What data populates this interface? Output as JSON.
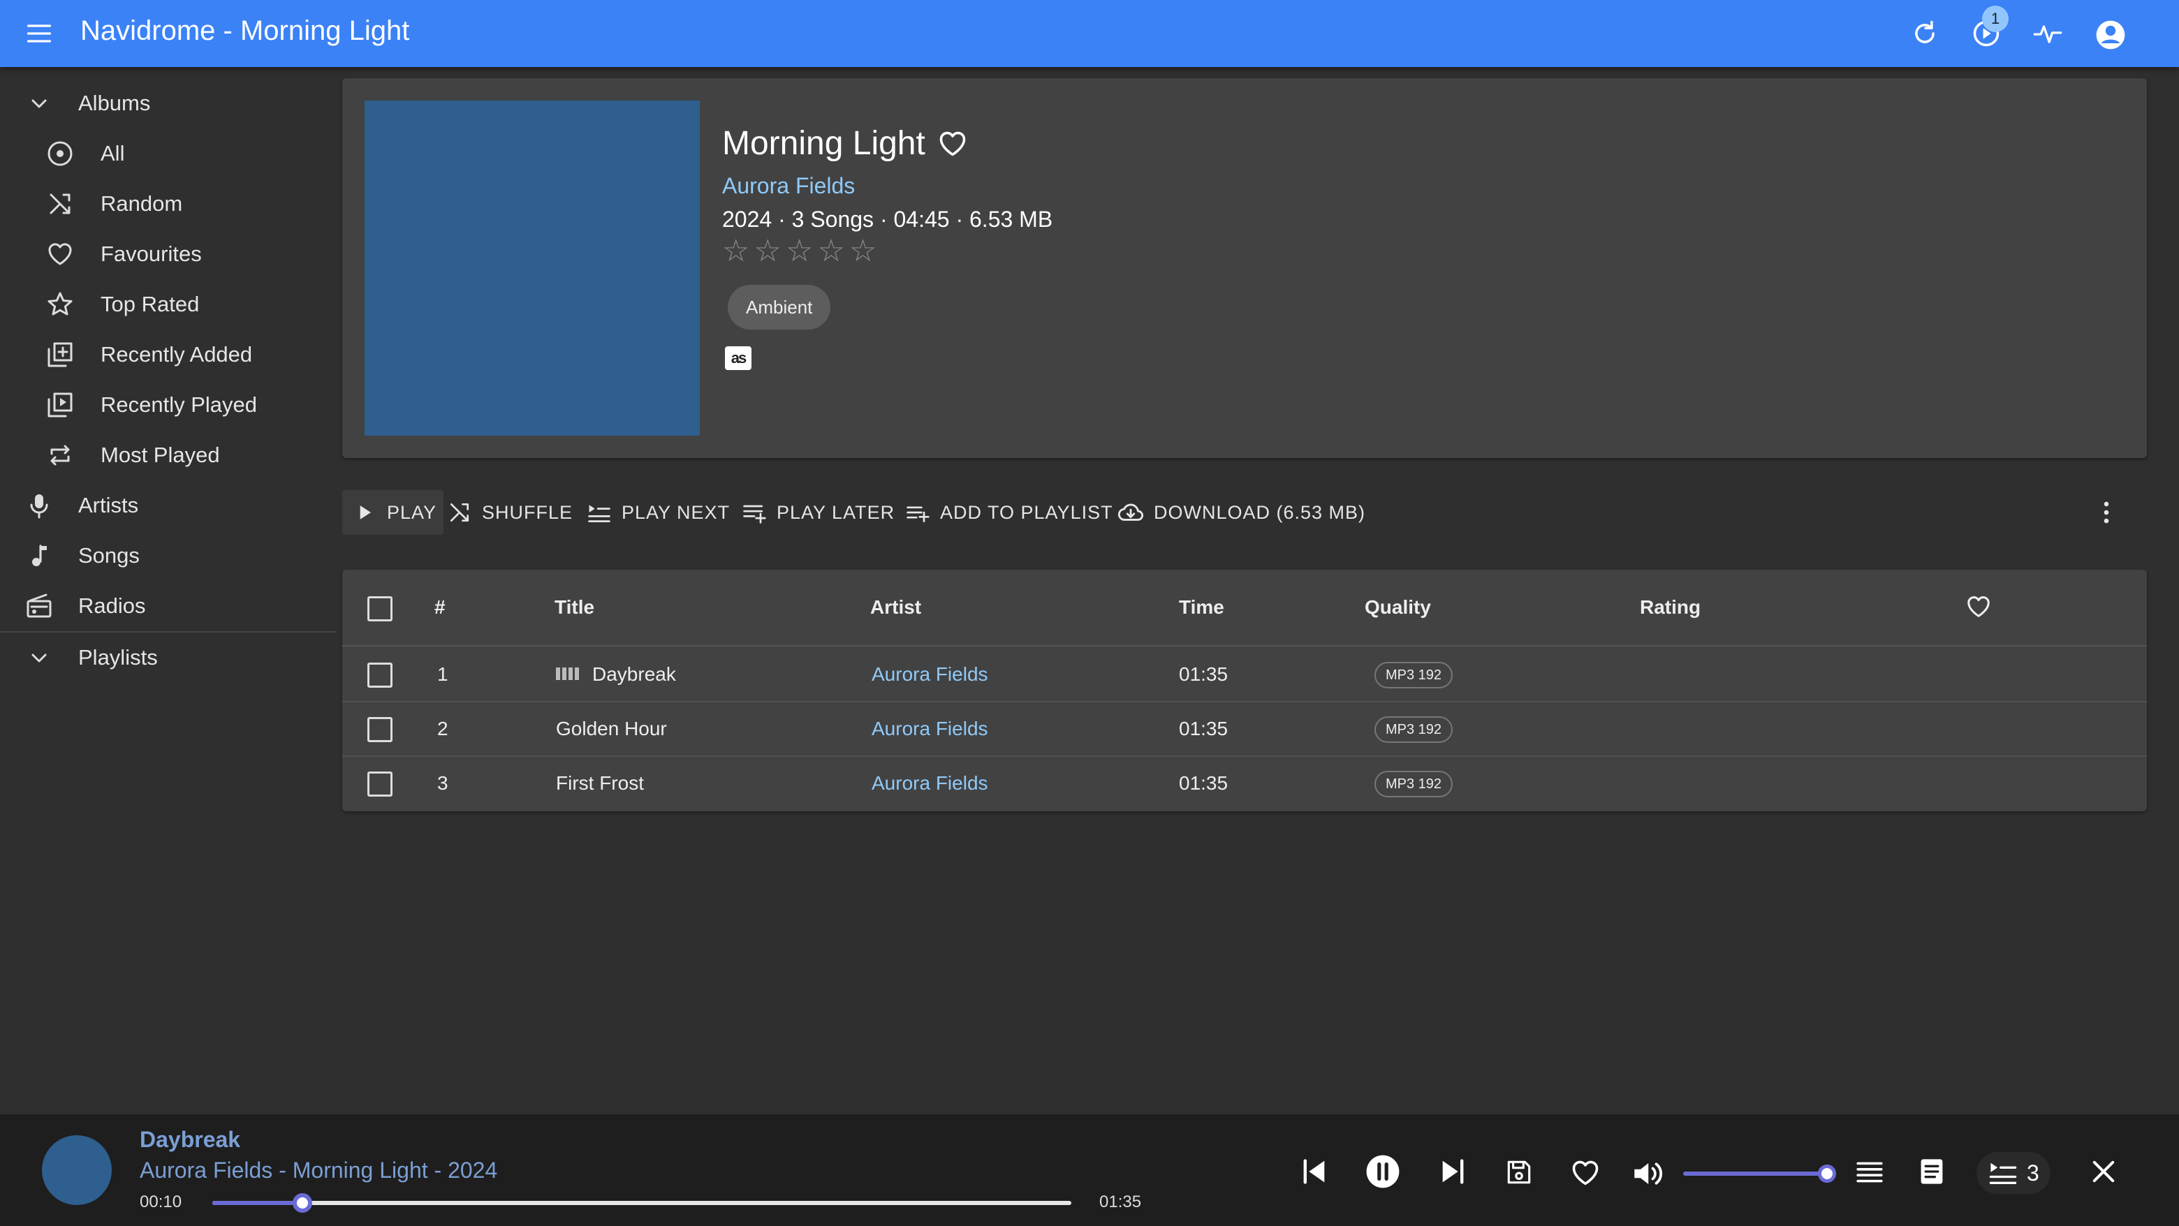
{
  "appbar": {
    "title": "Navidrome - Morning Light",
    "notification_count": "1",
    "icons": [
      "menu-icon",
      "refresh-icon",
      "activity-queue-icon",
      "pulse-icon",
      "account-icon"
    ]
  },
  "sidebar": {
    "albums_label": "Albums",
    "album_items": [
      {
        "label": "All",
        "icon": "album-icon"
      },
      {
        "label": "Random",
        "icon": "shuffle-icon"
      },
      {
        "label": "Favourites",
        "icon": "heart-icon"
      },
      {
        "label": "Top Rated",
        "icon": "star-icon"
      },
      {
        "label": "Recently Added",
        "icon": "library-add-icon"
      },
      {
        "label": "Recently Played",
        "icon": "video-library-icon"
      },
      {
        "label": "Most Played",
        "icon": "repeat-icon"
      }
    ],
    "items": [
      {
        "label": "Artists",
        "icon": "microphone-icon"
      },
      {
        "label": "Songs",
        "icon": "music-note-icon"
      },
      {
        "label": "Radios",
        "icon": "radio-icon"
      }
    ],
    "playlists_label": "Playlists"
  },
  "album": {
    "title": "Morning Light",
    "artist": "Aurora Fields",
    "meta": "2024 · 3 Songs · 04:45 · 6.53 MB",
    "rating": 0,
    "rating_max": 5,
    "genre": "Ambient",
    "lastfm_label": "as",
    "cover_color": "#2e5f8f"
  },
  "actions": {
    "play": "PLAY",
    "shuffle": "SHUFFLE",
    "play_next": "PLAY NEXT",
    "play_later": "PLAY LATER",
    "add_to_playlist": "ADD TO PLAYLIST",
    "download": "DOWNLOAD (6.53 MB)"
  },
  "table": {
    "columns": {
      "num": "#",
      "title": "Title",
      "artist": "Artist",
      "time": "Time",
      "quality": "Quality",
      "rating": "Rating"
    },
    "rows": [
      {
        "num": "1",
        "title": "Daybreak",
        "artist": "Aurora Fields",
        "time": "01:35",
        "quality": "MP3 192",
        "playing": true
      },
      {
        "num": "2",
        "title": "Golden Hour",
        "artist": "Aurora Fields",
        "time": "01:35",
        "quality": "MP3 192",
        "playing": false
      },
      {
        "num": "3",
        "title": "First Frost",
        "artist": "Aurora Fields",
        "time": "01:35",
        "quality": "MP3 192",
        "playing": false
      }
    ]
  },
  "player": {
    "title": "Daybreak",
    "subtitle": "Aurora Fields - Morning Light - 2024",
    "current_time": "00:10",
    "duration": "01:35",
    "progress_fraction": 0.105,
    "volume_fraction": 1.0,
    "queue_count": "3",
    "accent_color": "#6b6bd6"
  },
  "colors": {
    "appbar": "#3b82f6",
    "link": "#90caf9",
    "background": "#2f2f2f",
    "card": "#424242"
  }
}
